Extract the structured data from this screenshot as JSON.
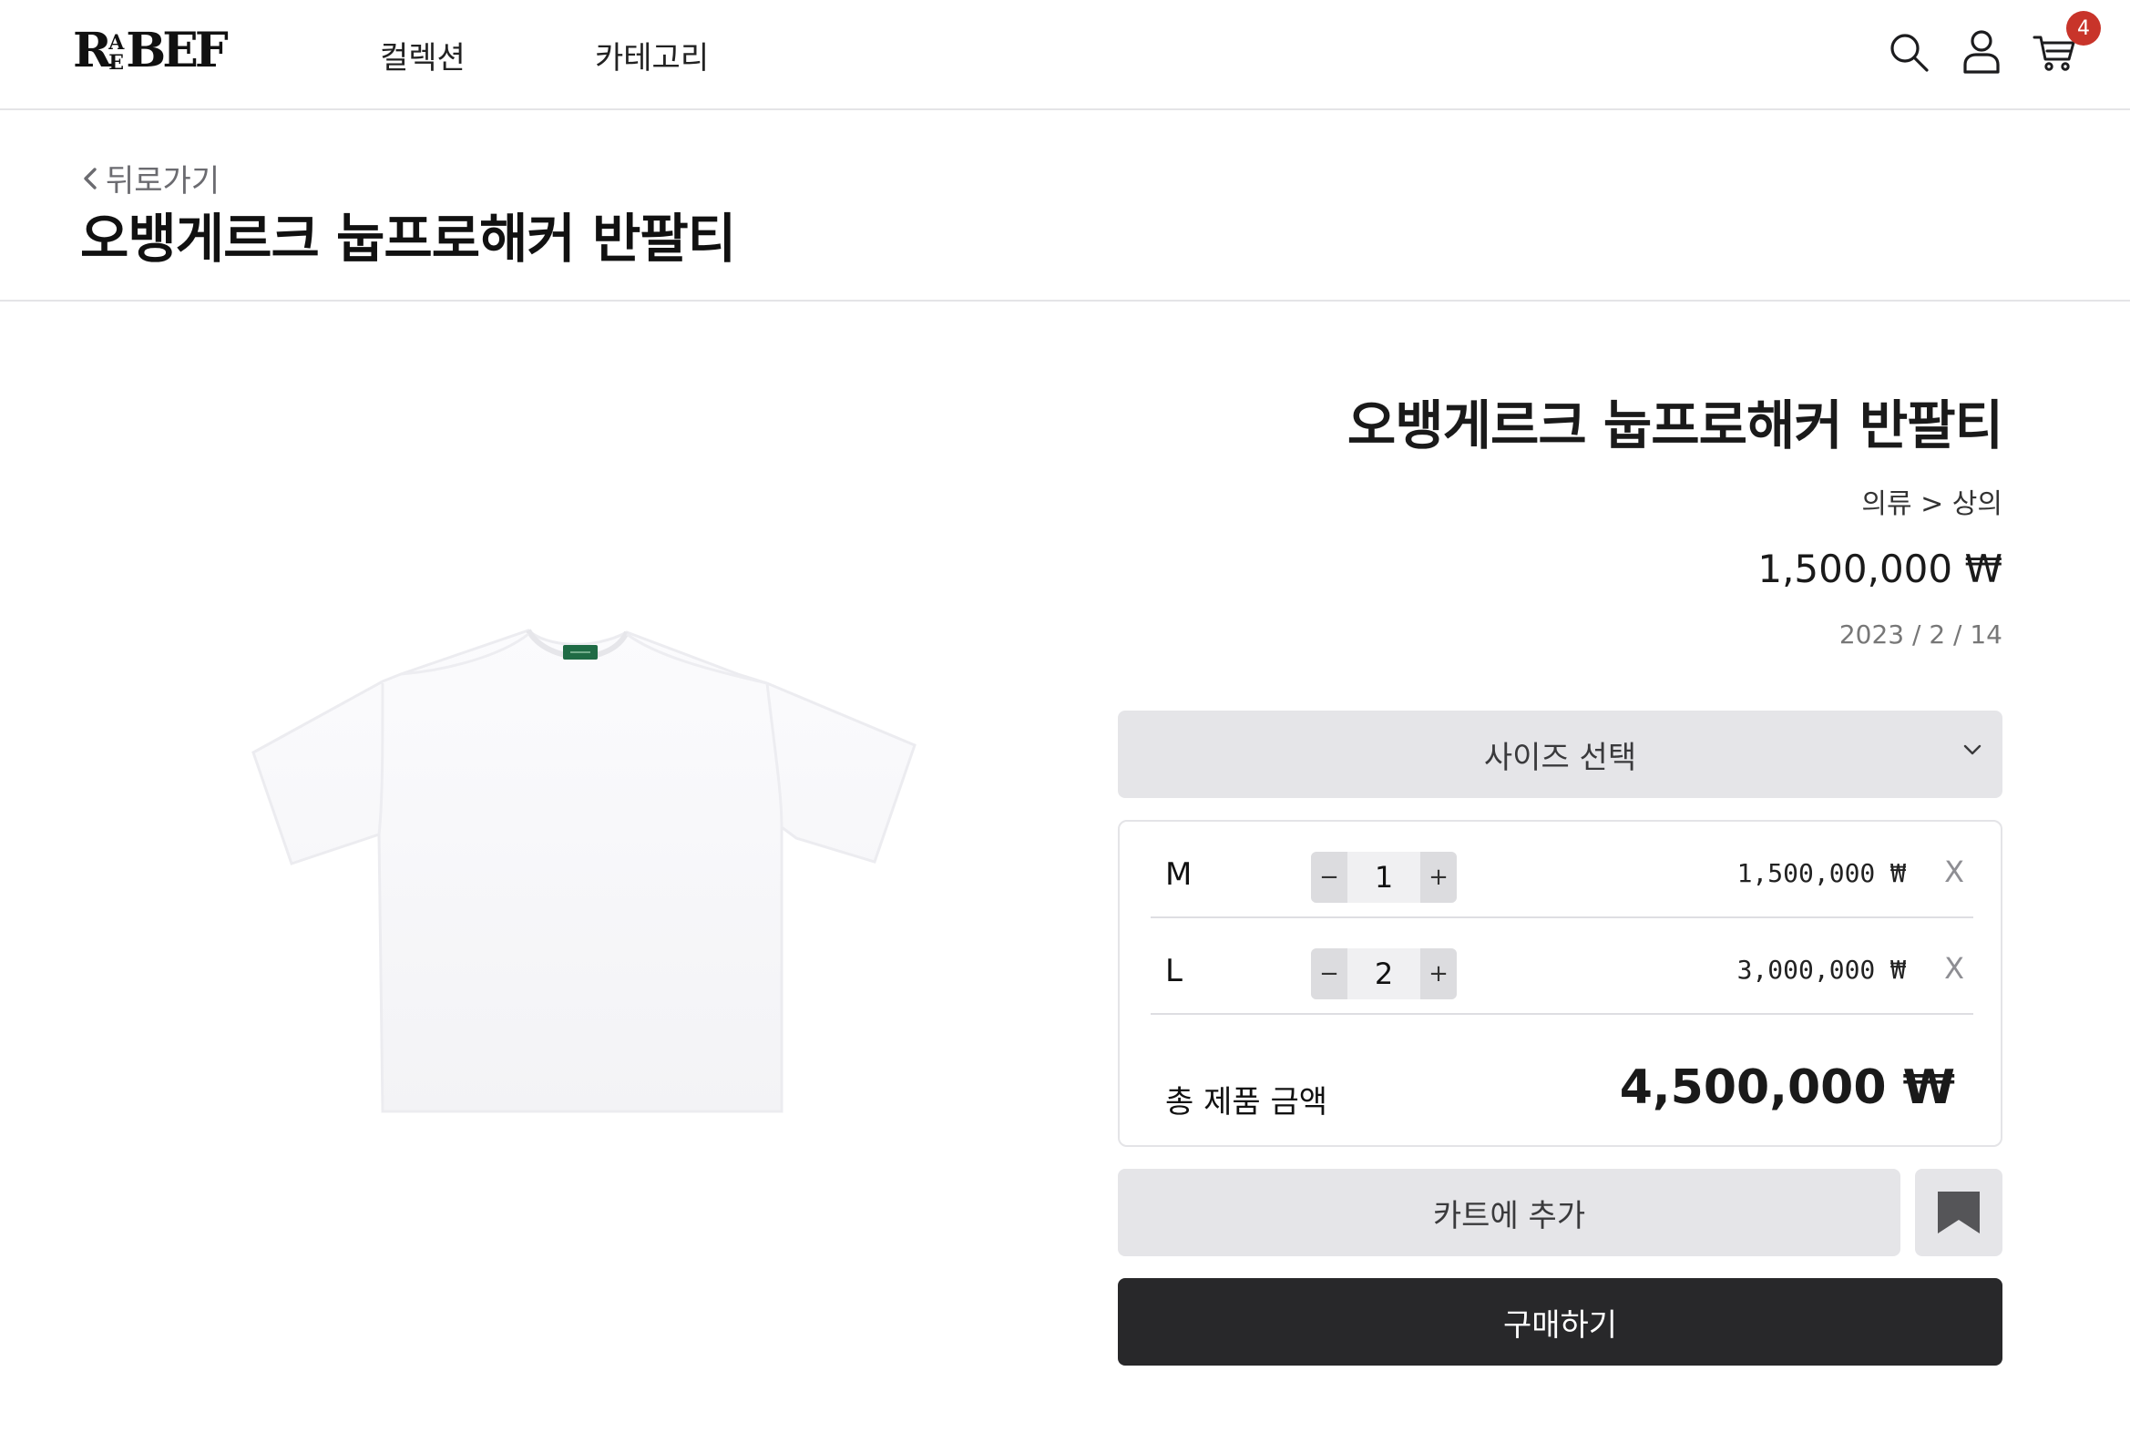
{
  "header": {
    "logo_main_left": "R",
    "logo_mini_top": "A",
    "logo_mini_bottom": "E",
    "logo_main_right": "BEF",
    "nav": [
      {
        "label": "컬렉션"
      },
      {
        "label": "카테고리"
      }
    ],
    "cart_count": "4",
    "icons": [
      "search-icon",
      "user-icon",
      "cart-icon"
    ]
  },
  "page": {
    "back_label": "뒤로가기",
    "title": "오뱅게르크 눕프로해커 반팔티"
  },
  "product": {
    "name": "오뱅게르크 눕프로해커 반팔티",
    "category_path": "의류 > 상의",
    "price": "1,500,000 ₩",
    "date": "2023 / 2 / 14",
    "size_select_label": "사이즈 선택",
    "options": [
      {
        "size": "M",
        "qty": "1",
        "price": "1,500,000 ₩",
        "remove": "X"
      },
      {
        "size": "L",
        "qty": "2",
        "price": "3,000,000 ₩",
        "remove": "X"
      }
    ],
    "stepper_minus": "−",
    "stepper_plus": "+",
    "total_label": "총 제품 금액",
    "total_value": "4,500,000 ₩",
    "add_to_cart_label": "카트에 추가",
    "buy_label": "구매하기"
  },
  "colors": {
    "accent_dark": "#28282a",
    "button_gray": "#e5e5e8",
    "badge_red": "#c8342a",
    "tag_green": "#1f6b45"
  }
}
